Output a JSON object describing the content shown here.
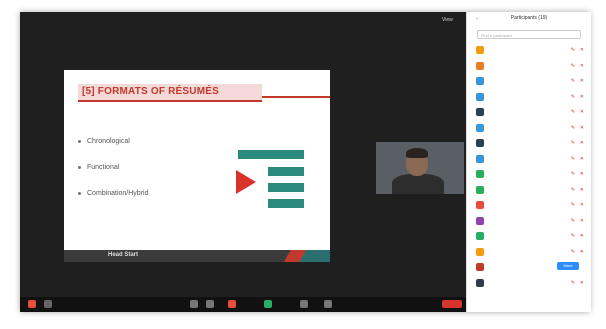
{
  "toolbar_top": {
    "view_label": "View"
  },
  "slide": {
    "title": "[5] FORMATS OF RÉSUMÉS",
    "bullets": [
      "Chronological",
      "Functional",
      "Combination/Hybrid"
    ],
    "footer_text": "Head Start",
    "accent_color": "#c0392b",
    "teal_color": "#2b8a7e"
  },
  "video": {
    "name_label": ""
  },
  "participants_panel": {
    "header": "Participants (19)",
    "search_placeholder": "Find a participant",
    "more_label": "More",
    "participants": [
      {
        "name": "",
        "avatar_color": "#f39c12"
      },
      {
        "name": "",
        "avatar_color": "#e67e22"
      },
      {
        "name": "",
        "avatar_color": "#3498db"
      },
      {
        "name": "",
        "avatar_color": "#3498db"
      },
      {
        "name": "",
        "avatar_color": "#2c3e50"
      },
      {
        "name": "",
        "avatar_color": "#3498db"
      },
      {
        "name": "",
        "avatar_color": "#2c3e50"
      },
      {
        "name": "",
        "avatar_color": "#3498db"
      },
      {
        "name": "",
        "avatar_color": "#27ae60"
      },
      {
        "name": "",
        "avatar_color": "#27ae60"
      },
      {
        "name": "",
        "avatar_color": "#e74c3c"
      },
      {
        "name": "",
        "avatar_color": "#8e44ad"
      },
      {
        "name": "",
        "avatar_color": "#27ae60"
      },
      {
        "name": "",
        "avatar_color": "#f39c12"
      },
      {
        "name": "",
        "avatar_color": "#c0392b"
      },
      {
        "name": "",
        "avatar_color": "#2c3e50"
      }
    ]
  }
}
